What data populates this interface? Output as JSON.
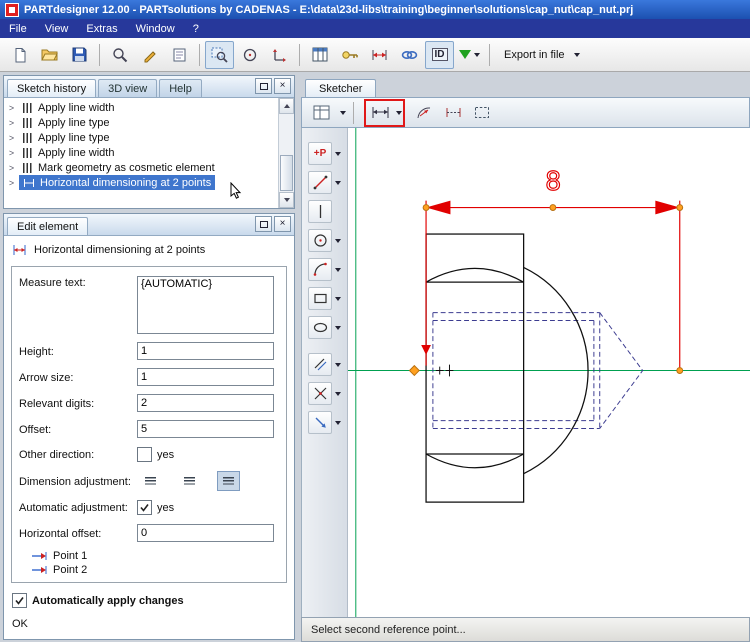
{
  "window": {
    "title": "PARTdesigner 12.00 - PARTsolutions by CADENAS - E:\\data\\23d-libs\\training\\beginner\\solutions\\cap_nut\\cap_nut.prj"
  },
  "menu": {
    "items": [
      {
        "label": "File"
      },
      {
        "label": "View"
      },
      {
        "label": "Extras"
      },
      {
        "label": "Window"
      },
      {
        "label": "?"
      }
    ]
  },
  "toolbar": {
    "export_label": "Export in file"
  },
  "icons": {
    "close": "×",
    "chevron": ">",
    "id_label": "ID",
    "point_tool": "+P"
  },
  "panels": {
    "sketch_history": {
      "tabs": [
        {
          "label": "Sketch history"
        },
        {
          "label": "3D view"
        },
        {
          "label": "Help"
        }
      ],
      "items": [
        {
          "label": "Apply line width"
        },
        {
          "label": "Apply line type"
        },
        {
          "label": "Apply line type"
        },
        {
          "label": "Apply line width"
        },
        {
          "label": "Mark geometry as cosmetic element"
        },
        {
          "label": "Horizontal dimensioning at 2 points"
        }
      ]
    },
    "edit_element": {
      "tab_label": "Edit element",
      "title": "Horizontal dimensioning at 2 points",
      "measure_text": {
        "label": "Measure text:",
        "value": "{AUTOMATIC}"
      },
      "height": {
        "label": "Height:",
        "value": "1"
      },
      "arrow_size": {
        "label": "Arrow size:",
        "value": "1"
      },
      "relevant_digits": {
        "label": "Relevant digits:",
        "value": "2"
      },
      "offset": {
        "label": "Offset:",
        "value": "5"
      },
      "other_direction": {
        "label": "Other direction:",
        "option": "yes"
      },
      "dimension_adjustment": {
        "label": "Dimension adjustment:"
      },
      "automatic_adjustment": {
        "label": "Automatic adjustment:",
        "option": "yes"
      },
      "horizontal_offset": {
        "label": "Horizontal offset:",
        "value": "0"
      },
      "point_1": "Point 1",
      "point_2": "Point 2",
      "apply_label": "Automatically apply changes",
      "status": "OK"
    }
  },
  "sketcher": {
    "tab_label": "Sketcher",
    "dimension_text": "8",
    "status": "Select second reference point...",
    "colors": {
      "dimension": "#e10000",
      "crosshair": "#00a050",
      "hidden_lines": "#3c3c90",
      "snap_point": "#ffa020"
    }
  }
}
